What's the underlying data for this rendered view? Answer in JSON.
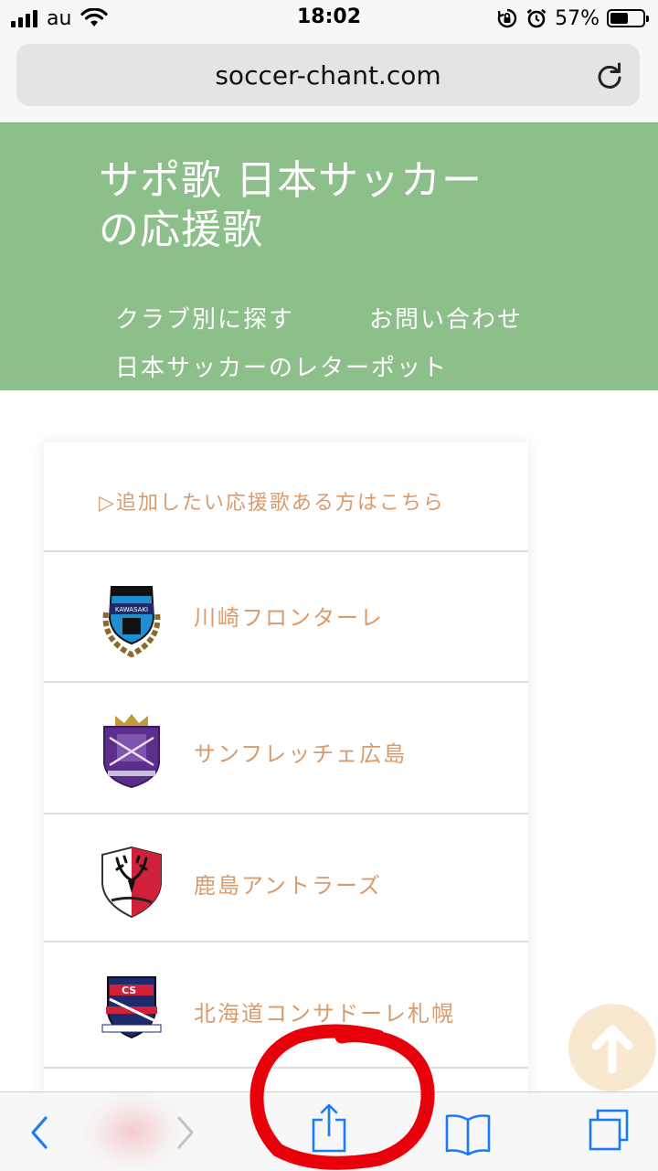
{
  "status_bar": {
    "carrier": "au",
    "time": "18:02",
    "battery_percent": "57%",
    "battery_level": 0.57
  },
  "browser": {
    "url": "soccer-chant.com",
    "reload_icon": "reload-icon"
  },
  "site": {
    "title_line1": "サポ歌 日本サッカー",
    "title_line2": "の応援歌",
    "nav": [
      {
        "label": "クラブ別に探す"
      },
      {
        "label": "お問い合わせ"
      },
      {
        "label": "日本サッカーのレターポット"
      }
    ]
  },
  "list": {
    "add_link": "▷追加したい応援歌ある方はこちら",
    "clubs": [
      {
        "name": "川崎フロンターレ",
        "logo": "kawasaki-frontale-emblem"
      },
      {
        "name": "サンフレッチェ広島",
        "logo": "sanfrecce-hiroshima-emblem"
      },
      {
        "name": "鹿島アントラーズ",
        "logo": "kashima-antlers-emblem"
      },
      {
        "name": "北海道コンサドーレ札幌",
        "logo": "consadole-sapporo-emblem"
      }
    ]
  },
  "toolbar": {
    "icons": [
      "back-icon",
      "forward-icon",
      "share-icon",
      "bookmarks-icon",
      "tabs-icon"
    ]
  },
  "colors": {
    "header_bg": "#8dbf8b",
    "link_orange": "#d99a6c",
    "annotation_red": "#e8000b",
    "ios_blue": "#1a7cf5"
  }
}
